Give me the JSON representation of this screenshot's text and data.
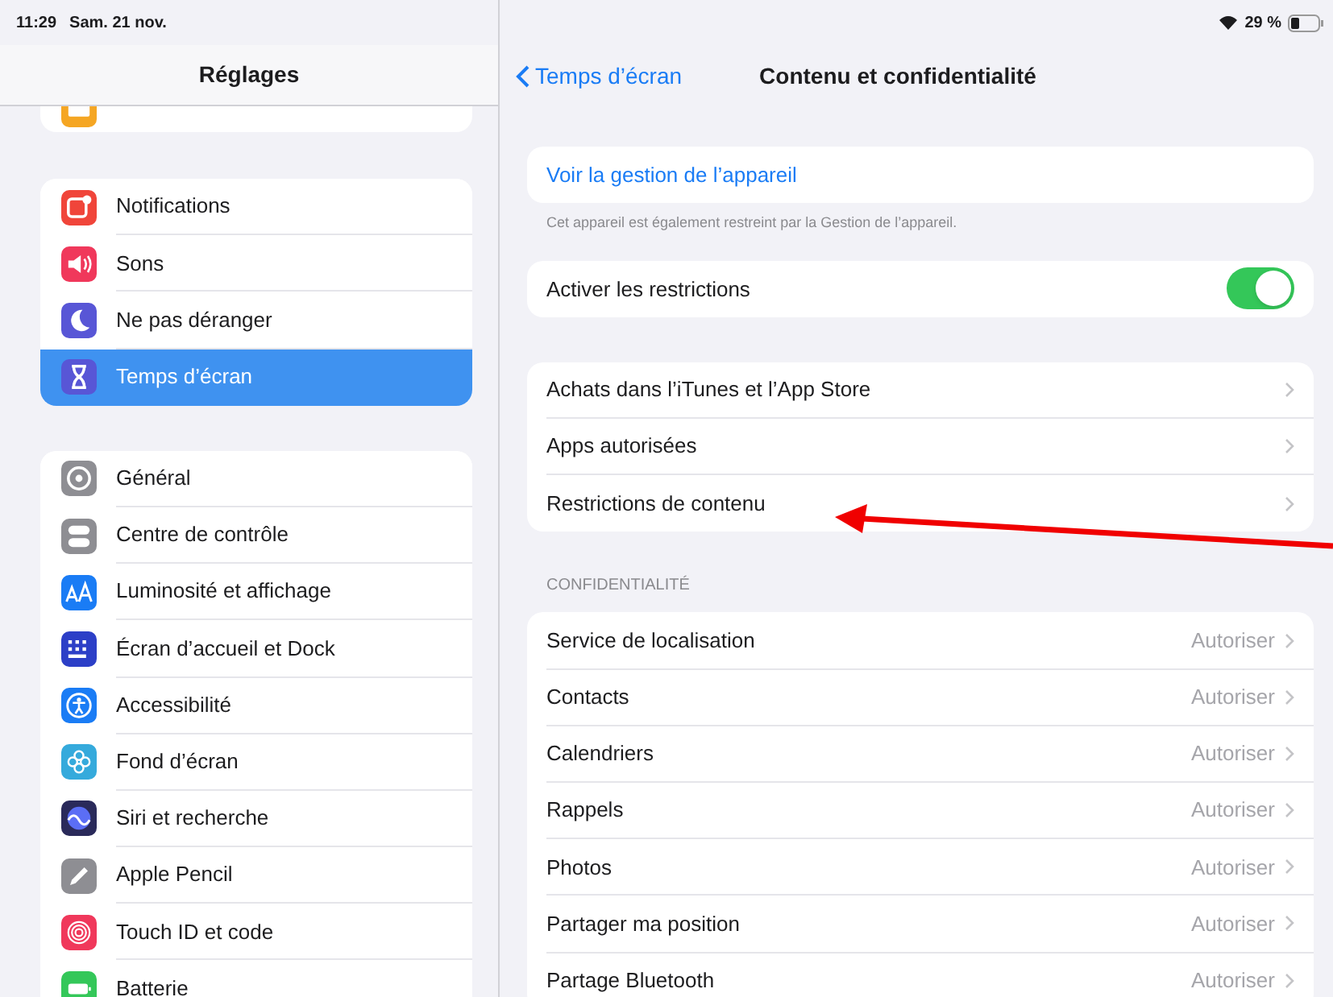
{
  "status_bar": {
    "time": "11:29",
    "date": "Sam. 21 nov.",
    "battery": "29 %"
  },
  "sidebar": {
    "title": "Réglages",
    "cut_off_item": {
      "kind": "classroom",
      "color": "#f5a623"
    },
    "groups": [
      {
        "items": [
          {
            "kind": "notifications",
            "label": "Notifications",
            "color": "#f0453a",
            "selected": false
          },
          {
            "kind": "sound",
            "label": "Sons",
            "color": "#f0385b",
            "selected": false
          },
          {
            "kind": "moon",
            "label": "Ne pas déranger",
            "color": "#5856d6",
            "selected": false
          },
          {
            "kind": "hourglass",
            "label": "Temps d’écran",
            "color": "#5856d6",
            "selected": true
          }
        ]
      },
      {
        "items": [
          {
            "kind": "gear",
            "label": "Général",
            "color": "#8e8e93",
            "selected": false
          },
          {
            "kind": "switches",
            "label": "Centre de contrôle",
            "color": "#8e8e93",
            "selected": false
          },
          {
            "kind": "text",
            "label": "Luminosité et affichage",
            "color": "#1a7cf5",
            "selected": false
          },
          {
            "kind": "grid",
            "label": "Écran d’accueil et Dock",
            "color": "#2c3fc7",
            "selected": false
          },
          {
            "kind": "person",
            "label": "Accessibilité",
            "color": "#1a7cf5",
            "selected": false
          },
          {
            "kind": "flower",
            "label": "Fond d’écran",
            "color": "#35aadc",
            "selected": false
          },
          {
            "kind": "siri",
            "label": "Siri et recherche",
            "color": "#2a2a5a",
            "selected": false
          },
          {
            "kind": "pencil",
            "label": "Apple Pencil",
            "color": "#8e8e93",
            "selected": false
          },
          {
            "kind": "fingerprint",
            "label": "Touch ID et code",
            "color": "#f0385b",
            "selected": false
          },
          {
            "kind": "battery",
            "label": "Batterie",
            "color": "#34c759",
            "selected": false
          }
        ]
      }
    ]
  },
  "detail": {
    "back": "Temps d’écran",
    "title": "Contenu et confidentialité",
    "groups": [
      {
        "rows": [
          {
            "kind": "link",
            "label": "Voir la gestion de l’appareil"
          }
        ],
        "footer": "Cet appareil est également restreint par la Gestion de l’appareil."
      },
      {
        "rows": [
          {
            "kind": "toggle",
            "label": "Activer les restrictions",
            "on": true
          }
        ]
      },
      {
        "rows": [
          {
            "kind": "nav",
            "label": "Achats dans l’iTunes et l’App Store"
          },
          {
            "kind": "nav",
            "label": "Apps autorisées"
          },
          {
            "kind": "nav",
            "label": "Restrictions de contenu"
          }
        ]
      },
      {
        "header": "CONFIDENTIALITÉ",
        "rows": [
          {
            "kind": "nav",
            "label": "Service de localisation",
            "value": "Autoriser"
          },
          {
            "kind": "nav",
            "label": "Contacts",
            "value": "Autoriser"
          },
          {
            "kind": "nav",
            "label": "Calendriers",
            "value": "Autoriser"
          },
          {
            "kind": "nav",
            "label": "Rappels",
            "value": "Autoriser"
          },
          {
            "kind": "nav",
            "label": "Photos",
            "value": "Autoriser"
          },
          {
            "kind": "nav",
            "label": "Partager ma position",
            "value": "Autoriser"
          },
          {
            "kind": "nav",
            "label": "Partage Bluetooth",
            "value": "Autoriser"
          }
        ]
      }
    ]
  }
}
